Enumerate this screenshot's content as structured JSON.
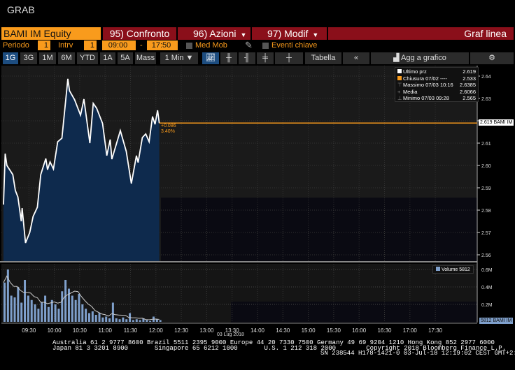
{
  "window": {
    "title": "GRAB"
  },
  "toolbar": {
    "security": "BAMI IM Equity",
    "compare": "95) Confronto",
    "actions": "96) Azioni",
    "modify": "97) Modif",
    "chart_type": "Graf linea"
  },
  "settings": {
    "period_label": "Periodo",
    "period_value": "1",
    "interval_label": "Intrv",
    "interval_value": "1",
    "start_time": "09:00",
    "dash": "-",
    "end_time": "17:50",
    "moving_avg": "Med Mob",
    "key_events": "Eventi chiave"
  },
  "ranges": [
    "1G",
    "3G",
    "1M",
    "6M",
    "YTD",
    "1A",
    "5A",
    "Mass"
  ],
  "interval_select": "1 Min ▼",
  "tools": {
    "table": "Tabella",
    "collapse": "«",
    "add": "Agg a grafico",
    "settings_icon": "⚙"
  },
  "legend": {
    "rows": [
      {
        "label": "Ultimo prz",
        "value": "2.619"
      },
      {
        "label": "Chiusura 07/02 ----",
        "value": "2.533"
      },
      {
        "label": "Massimo 07/03 10:16",
        "value": "2.6385"
      },
      {
        "label": "Media",
        "value": "2.6066"
      },
      {
        "label": "Minimo 07/03 09:28",
        "value": "2.565"
      }
    ]
  },
  "price_tag": "2.619 BAMI IM",
  "change": {
    "abs": "+0.086",
    "pct": "3.40%"
  },
  "volume_legend": "Volume 5812",
  "volume_tag": "5812 BAMI IM",
  "date_label": "03 Lug 2018",
  "colors": {
    "accent": "#f99b1c",
    "red": "#8a0f1a",
    "fill": "#0e2a4d",
    "volume": "#7fa0cc"
  },
  "footer": {
    "line1": "Australia 61 2 9777 8600 Brazil 5511 2395 9000 Europe 44 20 7330 7500 Germany 49 69 9204 1210 Hong Kong 852 2977 6000",
    "line2": "Japan 81 3 3201 8900       Singapore 65 6212 1000       U.S. 1 212 318 2000        Copyright 2018 Bloomberg Finance L.P.",
    "line3": "SN 238544 H178-1421-0 03-Jul-18 12:19:02 CEST GMT+2:00"
  },
  "chart_data": {
    "type": "line",
    "title": "BAMI IM Equity intraday",
    "x_unit": "minutes after 09:00",
    "price_ticks": [
      2.56,
      2.57,
      2.58,
      2.59,
      2.6,
      2.61,
      2.62,
      2.63,
      2.64
    ],
    "price_tick_labels": [
      "2.56",
      "2.57",
      "2.58",
      "2.59",
      "2.60",
      "2.61",
      "2.62",
      "2.63",
      "2.64"
    ],
    "time_ticks": [
      "09:30",
      "10:00",
      "10:30",
      "11:00",
      "11:30",
      "12:00",
      "12:30",
      "13:00",
      "13:30",
      "14:00",
      "14:30",
      "15:00",
      "15:30",
      "16:00",
      "16:30",
      "17:00",
      "17:30"
    ],
    "volume_ticks": [
      0.2,
      0.4,
      0.6
    ],
    "volume_tick_labels": [
      "0.2M",
      "0.4M",
      "0.6M"
    ],
    "last_price": 2.619,
    "x": [
      0,
      2,
      4,
      11,
      14,
      17,
      21,
      22,
      26,
      31,
      35,
      40,
      44,
      50,
      52,
      55,
      59,
      64,
      69,
      76,
      78,
      84,
      91,
      95,
      102,
      106,
      110,
      117,
      122,
      126,
      128,
      138,
      145,
      151,
      157,
      159,
      164,
      168,
      172,
      176,
      179,
      182,
      184
    ],
    "price": [
      2.5825,
      2.6053,
      2.6,
      2.5959,
      2.5888,
      2.5859,
      2.575,
      2.5809,
      2.5653,
      2.57,
      2.5772,
      2.5813,
      2.5959,
      2.6031,
      2.5981,
      2.6016,
      2.5984,
      2.6106,
      2.6122,
      2.6388,
      2.6334,
      2.6294,
      2.6225,
      2.6297,
      2.61,
      2.6278,
      2.6256,
      2.6188,
      2.6044,
      2.6116,
      2.6028,
      2.6156,
      2.6063,
      2.5919,
      2.6044,
      2.6013,
      2.6125,
      2.6141,
      2.6106,
      2.6219,
      2.6184,
      2.6247,
      2.619
    ],
    "volume_x": [
      0,
      4,
      8,
      12,
      16,
      20,
      24,
      28,
      32,
      36,
      40,
      44,
      48,
      52,
      56,
      60,
      64,
      68,
      72,
      76,
      80,
      84,
      88,
      92,
      96,
      100,
      104,
      108,
      112,
      116,
      120,
      124,
      128,
      132,
      136,
      140,
      144,
      148,
      152,
      156,
      160,
      164,
      168,
      172,
      176,
      180,
      184
    ],
    "volume_m": [
      0.45,
      0.6,
      0.3,
      0.28,
      0.4,
      0.22,
      0.48,
      0.3,
      0.25,
      0.2,
      0.15,
      0.22,
      0.3,
      0.17,
      0.25,
      0.2,
      0.15,
      0.35,
      0.48,
      0.38,
      0.3,
      0.25,
      0.32,
      0.2,
      0.15,
      0.1,
      0.12,
      0.08,
      0.1,
      0.05,
      0.06,
      0.04,
      0.22,
      0.04,
      0.03,
      0.05,
      0.03,
      0.1,
      0.02,
      0.03,
      0.02,
      0.04,
      0.02,
      0.01,
      0.06,
      0.03,
      0.02
    ]
  }
}
